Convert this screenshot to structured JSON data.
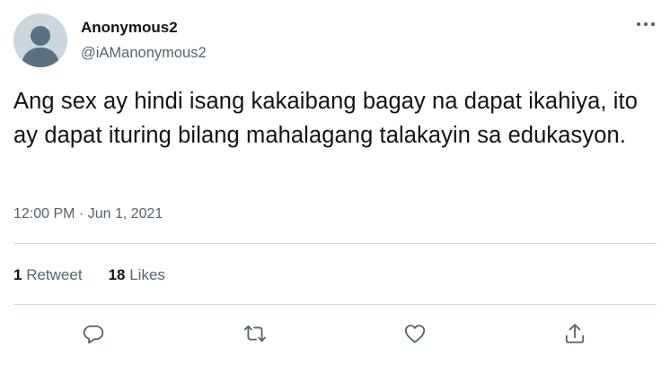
{
  "tweet": {
    "author": {
      "display_name": "Anonymous2",
      "handle": "@iAManonymous2",
      "avatar_icon": "default-avatar-icon"
    },
    "text": "Ang sex ay hindi isang kakaibang bagay na dapat ikahiya, ito ay dapat ituring bilang mahalagang talakayin sa edukasyon.",
    "time": "12:00 PM",
    "separator": " · ",
    "date": "Jun 1, 2021",
    "stats": [
      {
        "count": "1",
        "label": " Retweet"
      },
      {
        "count": "18",
        "label": " Likes"
      }
    ],
    "actions": [
      "reply-icon",
      "retweet-icon",
      "like-icon",
      "share-icon"
    ],
    "more_icon": "more-icon"
  },
  "colors": {
    "text_primary": "#0f1419",
    "text_secondary": "#536471",
    "divider": "#cfd9de",
    "avatar_bg": "#ccd6dd",
    "avatar_figure": "#5b7083"
  }
}
